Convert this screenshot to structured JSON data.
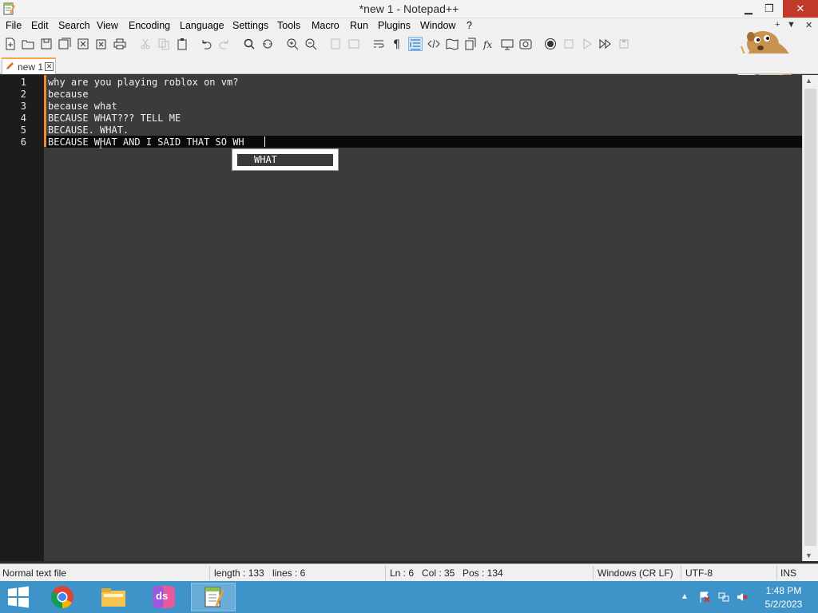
{
  "window": {
    "title": "*new 1 - Notepad++"
  },
  "menu": [
    "File",
    "Edit",
    "Search",
    "View",
    "Encoding",
    "Language",
    "Settings",
    "Tools",
    "Macro",
    "Run",
    "Plugins",
    "Window",
    "?"
  ],
  "menu_right": {
    "plus": "+",
    "down": "▼",
    "close": "✕"
  },
  "tab": {
    "label": "new 1"
  },
  "editor": {
    "line_numbers": [
      "1",
      "2",
      "3",
      "4",
      "5",
      "6"
    ],
    "lines": [
      "why are you playing roblox on vm?",
      "because",
      "because what",
      "BECAUSE WHAT??? TELL ME",
      "BECAUSE. WHAT.",
      "BECAUSE WHAT AND I SAID THAT SO WH"
    ]
  },
  "autocomplete": {
    "items": [
      "WHAT"
    ]
  },
  "status": {
    "file_type": "Normal text file",
    "length": "length : 133",
    "lines": "lines : 6",
    "ln": "Ln : 6",
    "col": "Col : 35",
    "pos": "Pos : 134",
    "eol": "Windows (CR LF)",
    "encoding": "UTF-8",
    "mode": "INS"
  },
  "taskbar": {
    "apps": [
      "chrome-icon",
      "file-explorer-icon",
      "ds-app-icon",
      "notepadpp-icon"
    ],
    "ds_label": "ds",
    "time": "1:48 PM",
    "date": "5/2/2023"
  },
  "colors": {
    "accent_orange": "#f18a2a",
    "taskbar": "#3e93c8",
    "close_red": "#c0392b"
  }
}
